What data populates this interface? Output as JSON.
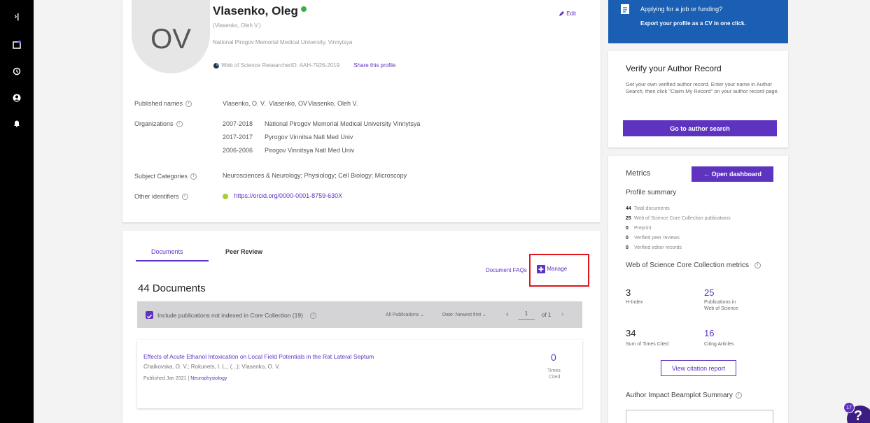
{
  "rail": {
    "expand": "›|",
    "icons": [
      "calendar-icon",
      "history-icon",
      "user-icon",
      "bell-icon"
    ]
  },
  "profile": {
    "initials": "OV",
    "name": "Vlasenko, Oleg",
    "alt_name": "(Vlasenko, Oleh V.)",
    "affiliation": "National Pirogov Memorial Medical University, Vinnytsya",
    "researcher_id": "Web of Science ResearcherID: AAH-7926-2019",
    "share": "Share this profile",
    "edit": "Edit"
  },
  "details": {
    "published_names_label": "Published names",
    "published_names": [
      "Vlasenko, O. V.",
      "Vlasenko, OV",
      "Vlasenko, Oleh V."
    ],
    "organizations_label": "Organizations",
    "organizations": [
      {
        "years": "2007-2018",
        "name": "National Pirogov Memorial Medical University Vinnytsya"
      },
      {
        "years": "2017-2017",
        "name": "Pyrogov Vinnitsa Natl Med Univ"
      },
      {
        "years": "2006-2006",
        "name": "Pirogov Vinnitsya Natl Med Univ"
      }
    ],
    "subject_label": "Subject Categories",
    "subjects": "Neurosciences & Neurology; Physiology; Cell Biology; Microscopy",
    "other_label": "Other identifiers",
    "orcid": "https://orcid.org/0000-0001-8759-630X"
  },
  "tabs": {
    "documents": "Documents",
    "peer": "Peer Review"
  },
  "docs": {
    "faq": "Document FAQs",
    "manage": "Manage",
    "count": "44 Documents",
    "include": "Include publications not indexed in Core Collection (19)",
    "filter": "All Publications ⌄",
    "sort": "Date: Newest first ⌄",
    "page": "1",
    "of": "of 1",
    "item": {
      "title": "Effects of Acute Ethanol Intoxication on Local Field Potentials in the Rat Lateral Septum",
      "authors": "Chaikovska, O. V.; Rokunets, I. L.; (...); Vlasenko, O. V.",
      "published": "Published Jan 2021 |",
      "journal": "Neurophysiology",
      "cited_num": "0",
      "cited_lbl1": "Times",
      "cited_lbl2": "Cited"
    }
  },
  "cv": {
    "title": "Applying for a job or funding?",
    "sub": "Export your profile as a CV in one click."
  },
  "verify": {
    "title": "Verify your Author Record",
    "text": "Get your own verified author record. Enter your name in Author Search, then click \"Claim My Record\" on your author record page.",
    "button": "Go to author search"
  },
  "metrics": {
    "title": "Metrics",
    "dashboard": "← Open dashboard",
    "summary": "Profile summary",
    "rows": [
      {
        "n": "44",
        "t": "Total documents"
      },
      {
        "n": "25",
        "t": "Web of Science Core Collection publications"
      },
      {
        "n": "0",
        "t": "Preprint"
      },
      {
        "n": "0",
        "t": "Verified peer reviews"
      },
      {
        "n": "0",
        "t": "Verified editor records"
      }
    ],
    "wos_title": "Web of Science Core Collection metrics",
    "h_num": "3",
    "h_lbl": "H-Index",
    "pub_num": "25",
    "pub_lbl1": "Publications in",
    "pub_lbl2": "Web of Science",
    "sum_num": "34",
    "sum_lbl": "Sum of Times Cited",
    "citing_num": "16",
    "citing_lbl": "Citing Articles",
    "report": "View citation report",
    "beamplot": "Author Impact Beamplot Summary"
  },
  "help": {
    "badge": "17",
    "glyph": "?"
  },
  "colors": {
    "accent": "#5e33bf",
    "banner": "#1a5fb4",
    "highlight": "#e0161b"
  }
}
